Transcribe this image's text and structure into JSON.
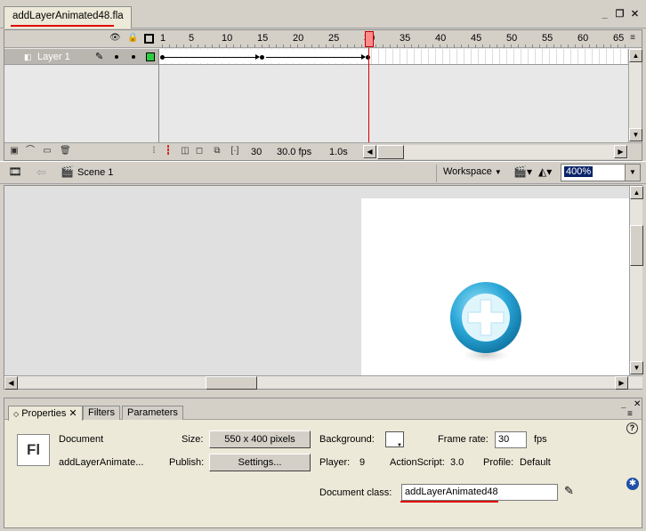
{
  "document_tab": {
    "title": "addLayerAnimated48.fla"
  },
  "timeline": {
    "ruler": [
      "1",
      "5",
      "10",
      "15",
      "20",
      "25",
      "30",
      "35",
      "40",
      "45",
      "50",
      "55",
      "60",
      "65"
    ],
    "layer": {
      "name": "Layer 1"
    },
    "status": {
      "current_frame": "30",
      "fps": "30.0 fps",
      "elapsed": "1.0s"
    }
  },
  "edit_bar": {
    "scene": "Scene 1",
    "workspace": "Workspace",
    "zoom": "400%"
  },
  "properties": {
    "tabs": [
      "Properties",
      "Filters",
      "Parameters"
    ],
    "icon_text": "Fl",
    "type_label": "Document",
    "doc_name": "addLayerAnimate...",
    "size_label": "Size:",
    "size_value": "550 x 400 pixels",
    "publish_label": "Publish:",
    "publish_button": "Settings...",
    "background_label": "Background:",
    "framerate_label": "Frame rate:",
    "framerate_value": "30",
    "fps_unit": "fps",
    "player_label": "Player:",
    "player_value": "9",
    "actionscript_label": "ActionScript:",
    "actionscript_value": "3.0",
    "profile_label": "Profile:",
    "profile_value": "Default",
    "docclass_label": "Document class:",
    "docclass_value": "addLayerAnimated48"
  },
  "colors": {
    "accent_underline": "#e00000",
    "playhead": "#d00000",
    "stage_bg": "#ffffff",
    "icon_blue": "#2aa7d8"
  }
}
